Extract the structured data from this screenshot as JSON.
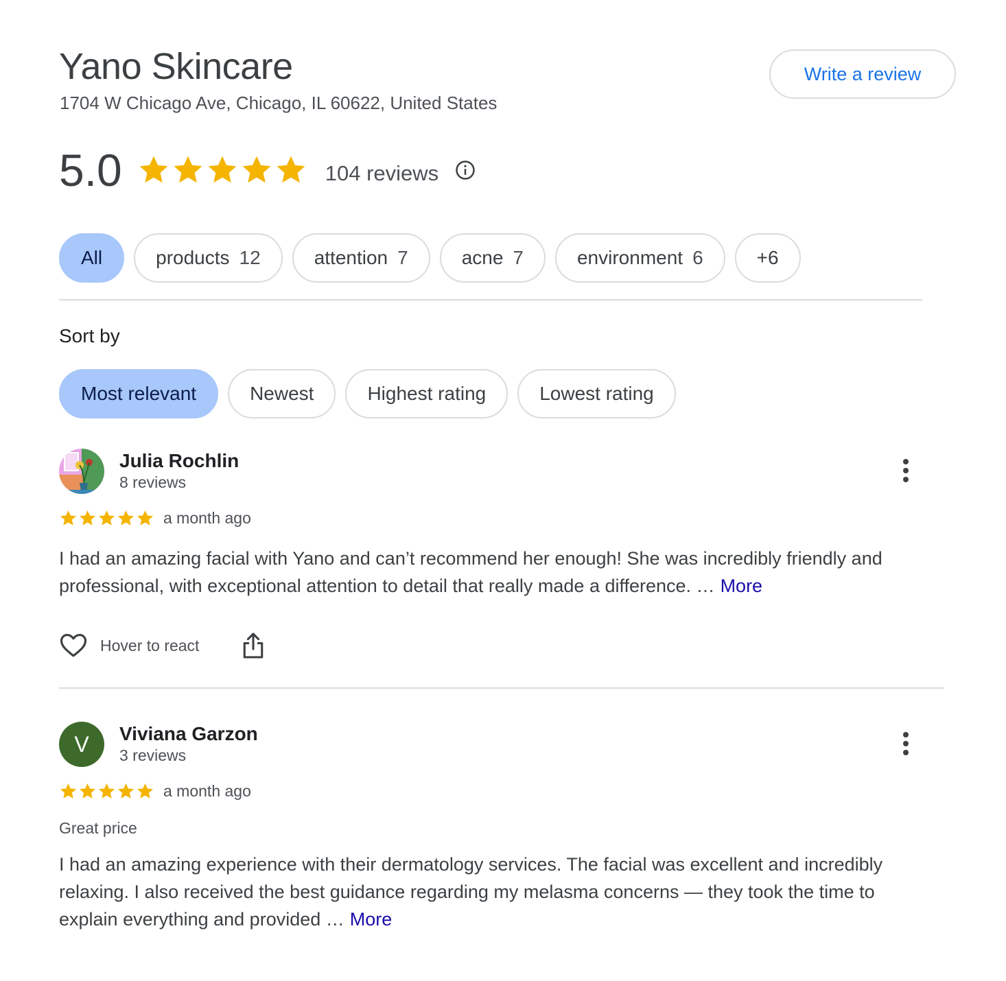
{
  "place": {
    "name": "Yano Skincare",
    "address": "1704 W Chicago Ave, Chicago, IL 60622, United States",
    "write_review_label": "Write a review"
  },
  "summary": {
    "rating": "5.0",
    "stars": 5,
    "review_count": "104 reviews",
    "info_icon": "info-icon"
  },
  "topics": [
    {
      "label": "All",
      "count": ""
    },
    {
      "label": "products",
      "count": "12"
    },
    {
      "label": "attention",
      "count": "7"
    },
    {
      "label": "acne",
      "count": "7"
    },
    {
      "label": "environment",
      "count": "6"
    },
    {
      "label": "+6",
      "count": ""
    }
  ],
  "sort": {
    "label": "Sort by",
    "options": [
      "Most relevant",
      "Newest",
      "Highest rating",
      "Lowest rating"
    ],
    "selected": "Most relevant"
  },
  "reviews": [
    {
      "name": "Julia Rochlin",
      "meta": "8 reviews",
      "stars": 5,
      "date": "a month ago",
      "tag": "",
      "text": "I had an amazing facial with Yano and can’t recommend her enough! She was incredibly friendly and professional, with exceptional attention to detail that really made a difference. …",
      "more_label": "More",
      "react_label": "Hover to react"
    },
    {
      "name": "Viviana Garzon",
      "initial": "V",
      "meta": "3 reviews",
      "stars": 5,
      "date": "a month ago",
      "tag": "Great price",
      "text": "I had an amazing experience with their dermatology services. The facial was excellent and incredibly relaxing. I also received the best guidance regarding my melasma concerns — they took the time to explain everything and provided …",
      "more_label": "More"
    }
  ],
  "colors": {
    "star": "#F4B400",
    "chip_active": "#A8C7FA",
    "link": "#1A0DAB",
    "accent": "#1A73E8",
    "avatar_v": "#3D6A2A"
  }
}
